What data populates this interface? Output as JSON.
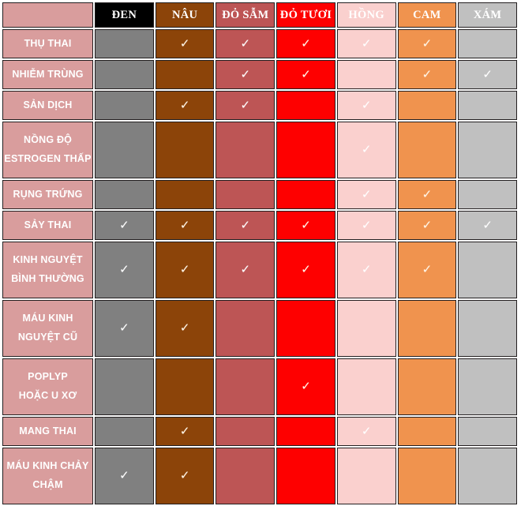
{
  "table": {
    "corner_label": "",
    "columns": [
      {
        "key": "den",
        "label": "ĐEN",
        "color": "#000000",
        "body_color": "#808080"
      },
      {
        "key": "nau",
        "label": "NÂU",
        "color": "#8c4409",
        "body_color": "#8c4409"
      },
      {
        "key": "dosam",
        "label": "ĐỎ SẪM",
        "color": "#bd5555",
        "body_color": "#bd5555"
      },
      {
        "key": "dotuoi",
        "label": "ĐỎ TƯƠI",
        "color": "#fe0000",
        "body_color": "#fe0000"
      },
      {
        "key": "hong",
        "label": "HỒNG",
        "color": "#fad0ce",
        "body_color": "#fad0ce"
      },
      {
        "key": "cam",
        "label": "CAM",
        "color": "#f0934e",
        "body_color": "#f0934e"
      },
      {
        "key": "xam",
        "label": "XÁM",
        "color": "#c0c0c0",
        "body_color": "#c0c0c0"
      }
    ],
    "row_label_color": "#d99d9d",
    "check_glyph": "✓",
    "rows": [
      {
        "label_lines": [
          "THỤ THAI"
        ],
        "checks": [
          false,
          true,
          true,
          true,
          true,
          true,
          false
        ]
      },
      {
        "label_lines": [
          "NHIỄM TRÙNG"
        ],
        "checks": [
          false,
          false,
          true,
          true,
          false,
          true,
          true
        ]
      },
      {
        "label_lines": [
          "SẢN DỊCH"
        ],
        "checks": [
          false,
          true,
          true,
          false,
          true,
          false,
          false
        ]
      },
      {
        "label_lines": [
          "NỒNG ĐỘ",
          "ESTROGEN THẤP"
        ],
        "checks": [
          false,
          false,
          false,
          false,
          true,
          false,
          false
        ]
      },
      {
        "label_lines": [
          "RỤNG TRỨNG"
        ],
        "checks": [
          false,
          false,
          false,
          false,
          true,
          true,
          false
        ]
      },
      {
        "label_lines": [
          "SẢY THAI"
        ],
        "checks": [
          true,
          true,
          true,
          true,
          true,
          true,
          true
        ]
      },
      {
        "label_lines": [
          "KINH NGUYỆT",
          "BÌNH THƯỜNG"
        ],
        "checks": [
          true,
          true,
          true,
          true,
          true,
          true,
          false
        ]
      },
      {
        "label_lines": [
          "MÁU KINH",
          "NGUYỆT CŨ"
        ],
        "checks": [
          true,
          true,
          false,
          false,
          false,
          false,
          false
        ]
      },
      {
        "label_lines": [
          "POPLYP",
          "HOẶC U XƠ"
        ],
        "checks": [
          false,
          false,
          false,
          true,
          false,
          false,
          false
        ]
      },
      {
        "label_lines": [
          "MANG THAI"
        ],
        "checks": [
          false,
          true,
          false,
          false,
          true,
          false,
          false
        ]
      },
      {
        "label_lines": [
          "MÁU KINH CHẢY",
          "CHẬM"
        ],
        "checks": [
          true,
          true,
          false,
          false,
          false,
          false,
          false
        ]
      }
    ]
  },
  "chart_data": {
    "type": "table",
    "title": "",
    "xlabel": "",
    "ylabel": "",
    "categories": [
      "ĐEN",
      "NÂU",
      "ĐỎ SẪM",
      "ĐỎ TƯƠI",
      "HỒNG",
      "CAM",
      "XÁM"
    ],
    "row_categories": [
      "THỤ THAI",
      "NHIỄM TRÙNG",
      "SẢN DỊCH",
      "NỒNG ĐỘ ESTROGEN THẤP",
      "RỤNG TRỨNG",
      "SẢY THAI",
      "KINH NGUYỆT BÌNH THƯỜNG",
      "MÁU KINH NGUYỆT CŨ",
      "POPLYP HOẶC U XƠ",
      "MANG THAI",
      "MÁU KINH CHẢY CHẬM"
    ],
    "series": [
      {
        "name": "THỤ THAI",
        "values": [
          0,
          1,
          1,
          1,
          1,
          1,
          0
        ]
      },
      {
        "name": "NHIỄM TRÙNG",
        "values": [
          0,
          0,
          1,
          1,
          0,
          1,
          1
        ]
      },
      {
        "name": "SẢN DỊCH",
        "values": [
          0,
          1,
          1,
          0,
          1,
          0,
          0
        ]
      },
      {
        "name": "NỒNG ĐỘ ESTROGEN THẤP",
        "values": [
          0,
          0,
          0,
          0,
          1,
          0,
          0
        ]
      },
      {
        "name": "RỤNG TRỨNG",
        "values": [
          0,
          0,
          0,
          0,
          1,
          1,
          0
        ]
      },
      {
        "name": "SẢY THAI",
        "values": [
          1,
          1,
          1,
          1,
          1,
          1,
          1
        ]
      },
      {
        "name": "KINH NGUYỆT BÌNH THƯỜNG",
        "values": [
          1,
          1,
          1,
          1,
          1,
          1,
          0
        ]
      },
      {
        "name": "MÁU KINH NGUYỆT CŨ",
        "values": [
          1,
          1,
          0,
          0,
          0,
          0,
          0
        ]
      },
      {
        "name": "POPLYP HOẶC U XƠ",
        "values": [
          0,
          0,
          0,
          1,
          0,
          0,
          0
        ]
      },
      {
        "name": "MANG THAI",
        "values": [
          0,
          1,
          0,
          0,
          1,
          0,
          0
        ]
      },
      {
        "name": "MÁU KINH CHẢY CHẬM",
        "values": [
          1,
          1,
          0,
          0,
          0,
          0,
          0
        ]
      }
    ],
    "legend": [],
    "grid": true,
    "notes": "Matrix mapping menstrual blood colour (columns) to possible conditions (rows); a check mark means the colour is associated with that condition."
  }
}
